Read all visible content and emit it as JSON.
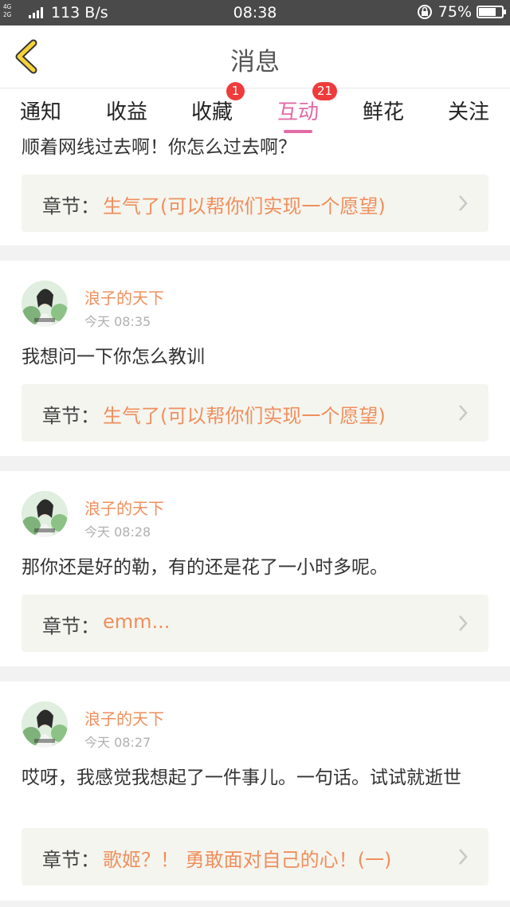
{
  "status_bar": {
    "network_top": "4G",
    "network_bottom": "2G",
    "speed": "113 B/s",
    "time": "08:38",
    "battery": "75%",
    "battery_level": 0.75
  },
  "header": {
    "title": "消息"
  },
  "tabs": [
    {
      "label": "通知",
      "badge": ""
    },
    {
      "label": "收益",
      "badge": ""
    },
    {
      "label": "收藏",
      "badge": "1"
    },
    {
      "label": "互动",
      "badge": "21"
    },
    {
      "label": "鲜花",
      "badge": ""
    },
    {
      "label": "关注",
      "badge": ""
    }
  ],
  "active_tab": "互动",
  "colors": {
    "accent": "#e26ba4",
    "name": "#ef8f5d",
    "badge": "#ef3b3b"
  },
  "chapter_label": "章节：",
  "partial_item": {
    "message": "顺着网线过去啊！你怎么过去啊？",
    "chapter": "生气了(可以帮你们实现一个愿望)"
  },
  "items": [
    {
      "user": "浪子的天下",
      "time": "今天 08:35",
      "message": "我想问一下你怎么教训",
      "chapter": "生气了(可以帮你们实现一个愿望)"
    },
    {
      "user": "浪子的天下",
      "time": "今天 08:28",
      "message": "那你还是好的勒，有的还是花了一小时多呢。",
      "chapter": "emm..."
    },
    {
      "user": "浪子的天下",
      "time": "今天 08:27",
      "message": "哎呀，我感觉我想起了一件事儿。一句话。试试就逝世",
      "chapter": "歌姬？！ 勇敢面对自己的心！(一)"
    }
  ]
}
